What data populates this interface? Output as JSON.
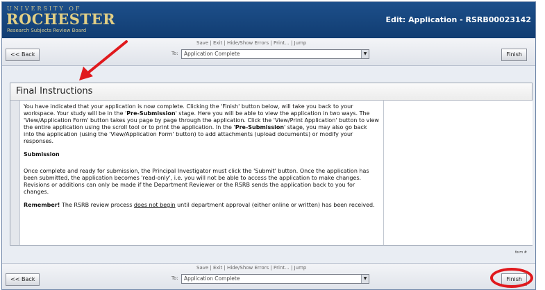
{
  "header": {
    "logo_university": "UNIVERSITY OF",
    "logo_name": "ROCHESTER",
    "logo_subtitle": "Research Subjects Review Board",
    "title": "Edit: Application - RSRB00023142"
  },
  "nav": {
    "back_label": "<< Back",
    "finish_label": "Finish",
    "links": "Save | Exit | Hide/Show Errors | Print... | Jump",
    "jump_to_label": "To:",
    "jump_value": "Application Complete"
  },
  "panel": {
    "title": "Final Instructions",
    "para1_a": "You have indicated that your application is now complete. Clicking the 'Finish' button below, will take you back to your workspace. Your study will be in the '",
    "para1_b": "Pre-Submission",
    "para1_c": "' stage. Here you will be able to view the application in two ways. The 'View/Application Form' button takes you page by page through the application. Click the 'View/Print Application' button to view the entire application using the scroll tool or to print the application. In the '",
    "para1_d": "Pre-Submission",
    "para1_e": "' stage, you may also go back into the application (using the 'View/Application Form' button) to add attachments (upload documents) or modify your responses.",
    "submission_heading": "Submission",
    "para2": "Once complete and ready for submission, the Principal Investigator must click the 'Submit' button. Once the application has been submitted, the application becomes 'read-only', i.e. you will not be able to access the application to make changes. Revisions or additions can only be made if the Department Reviewer or the RSRB sends the application back to you for changes.",
    "remember_bold": "Remember!",
    "remember_a": " The RSRB review process ",
    "remember_underline": "does not begin",
    "remember_b": " until department approval (either online or written) has been received."
  },
  "footer": {
    "form_number": "form #"
  },
  "colors": {
    "header_bg": "#1a4a85",
    "logo_gold": "#e2cf85",
    "annotation_red": "#e0191d"
  }
}
